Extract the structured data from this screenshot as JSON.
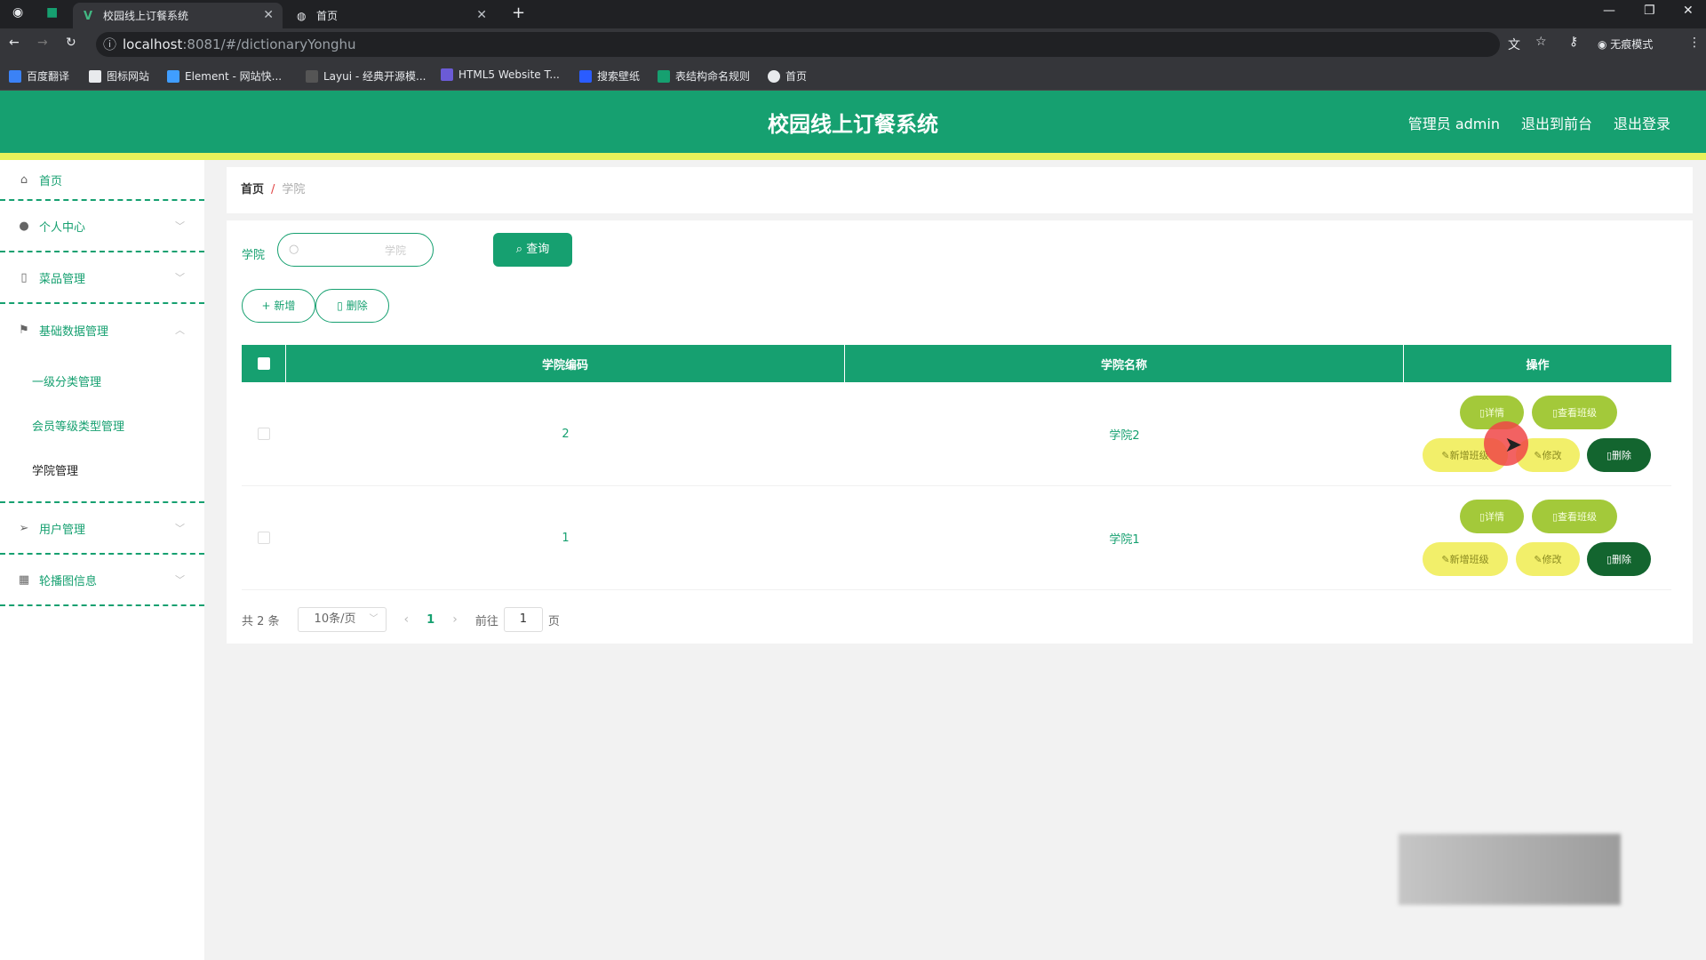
{
  "browser": {
    "tabs": [
      {
        "title": "校园线上订餐系统",
        "active": true
      },
      {
        "title": "首页",
        "active": false
      }
    ],
    "url_host": "localhost",
    "url_path": ":8081/#/dictionaryYonghu",
    "profile_label": "无痕模式",
    "bookmarks": [
      "百度翻译",
      "图标网站",
      "Element - 网站快...",
      "Layui - 经典开源模...",
      "HTML5 Website T...",
      "搜索壁纸",
      "表结构命名规则",
      "首页"
    ]
  },
  "header": {
    "title": "校园线上订餐系统",
    "admin_label": "管理员 admin",
    "front_label": "退出到前台",
    "logout_label": "退出登录"
  },
  "sidebar": {
    "items": [
      {
        "label": "首页",
        "icon": "home-icon"
      },
      {
        "label": "个人中心",
        "icon": "user-icon"
      },
      {
        "label": "菜品管理",
        "icon": "phone-icon"
      },
      {
        "label": "基础数据管理",
        "icon": "flag-icon"
      },
      {
        "label": "用户管理",
        "icon": "send-icon"
      },
      {
        "label": "轮播图信息",
        "icon": "calendar-icon"
      }
    ],
    "submenu": [
      "一级分类管理",
      "会员等级类型管理",
      "学院管理"
    ]
  },
  "breadcrumb": {
    "home": "首页",
    "sep": "/",
    "current": "学院"
  },
  "search": {
    "label": "学院",
    "placeholder": "学院",
    "query_button": "查询"
  },
  "actions": {
    "add": "新增",
    "delete": "删除"
  },
  "table": {
    "headers": [
      "学院编码",
      "学院名称",
      "操作"
    ],
    "rows": [
      {
        "code": "2",
        "name": "学院2"
      },
      {
        "code": "1",
        "name": "学院1"
      }
    ],
    "ops": {
      "detail": "详情",
      "view_class": "查看班级",
      "add_class": "新增班级",
      "edit": "修改",
      "delete": "删除"
    }
  },
  "pagination": {
    "total": "共 2 条",
    "page_size": "10条/页",
    "current_page": "1",
    "goto_label": "前往",
    "goto_value": "1",
    "page_suffix": "页"
  },
  "colors": {
    "primary": "#16a070",
    "accent_bar": "#e8f25a",
    "op_green": "#a3c93a",
    "op_yellow": "#f2ef6a",
    "op_dark": "#13652f"
  }
}
